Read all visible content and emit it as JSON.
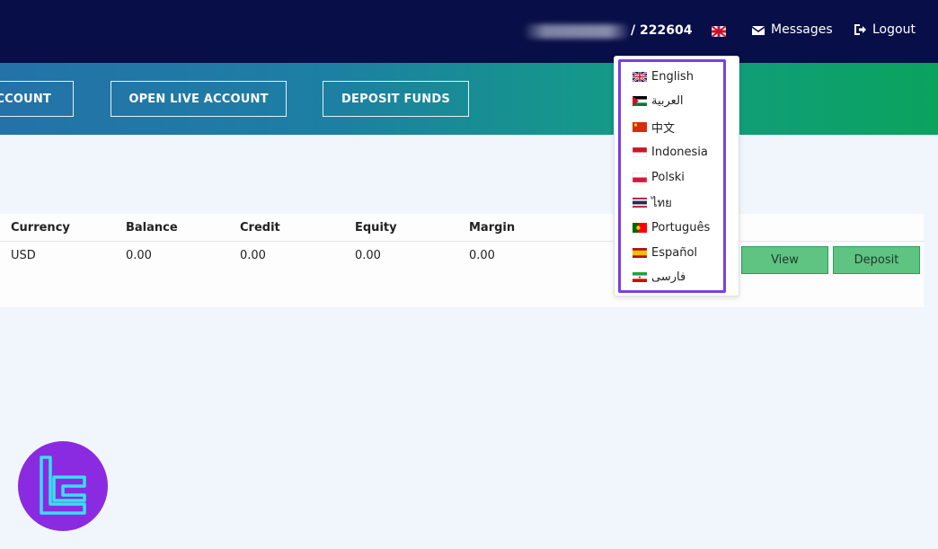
{
  "header": {
    "account_number": "/ 222604",
    "messages_label": "Messages",
    "logout_label": "Logout"
  },
  "banner": {
    "buttons": [
      "CCOUNT",
      "OPEN LIVE ACCOUNT",
      "DEPOSIT FUNDS"
    ]
  },
  "table": {
    "columns": [
      "Currency",
      "Balance",
      "Credit",
      "Equity",
      "Margin"
    ],
    "rows": [
      {
        "currency": "USD",
        "balance": "0.00",
        "credit": "0.00",
        "equity": "0.00",
        "margin": "0.00",
        "view_label": "View",
        "deposit_label": "Deposit"
      }
    ]
  },
  "language_menu": {
    "items": [
      {
        "label": "English",
        "flag": "uk-flag-icon"
      },
      {
        "label": "العربية",
        "flag": "jordan-flag-icon"
      },
      {
        "label": "中文",
        "flag": "china-flag-icon"
      },
      {
        "label": "Indonesia",
        "flag": "indonesia-flag-icon"
      },
      {
        "label": "Polski",
        "flag": "poland-flag-icon"
      },
      {
        "label": "ไทย",
        "flag": "thailand-flag-icon"
      },
      {
        "label": "Português",
        "flag": "portugal-flag-icon"
      },
      {
        "label": "Español",
        "flag": "spain-flag-icon"
      },
      {
        "label": "فارسی",
        "flag": "iran-flag-icon"
      }
    ]
  },
  "colors": {
    "header_bg": "#080e47",
    "highlight": "#7a3fe0",
    "action_button": "#5fc382",
    "logo_bg": "#8a2be2",
    "logo_stroke": "#37e0f0"
  }
}
